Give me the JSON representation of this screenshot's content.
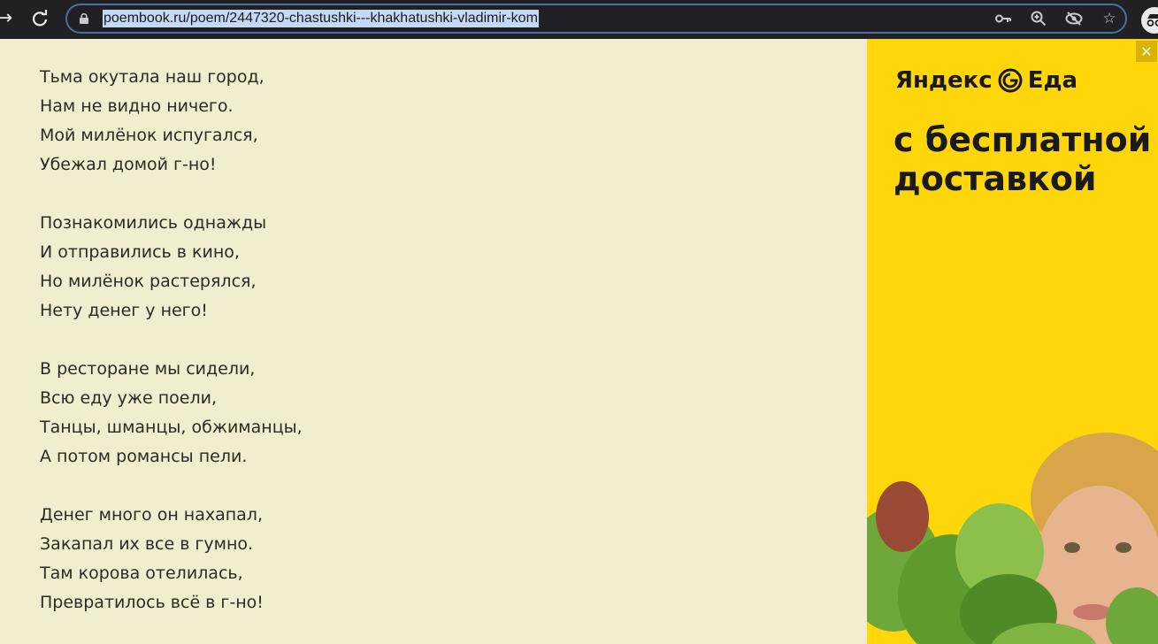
{
  "browser": {
    "url": "poembook.ru/poem/2447320-chastushki---khakhatushki-vladimir-kom"
  },
  "poem": {
    "lines": [
      "Тьма окутала наш город,",
      "Нам не видно ничего.",
      "Мой милёнок испугался,",
      "Убежал домой г-но!",
      "Познакомились однажды",
      "И отправились в кино,",
      "Но милёнок растерялся,",
      "Нету денег у него!",
      "В ресторане мы сидели,",
      "Всю еду уже поели,",
      "Танцы, шманцы, обжиманцы,",
      "А потом романсы пели.",
      "Денег много он нахапал,",
      "Закапал их все в гумно.",
      "Там корова отелилась,",
      "Превратилось всё в г-но!"
    ]
  },
  "ad": {
    "brand_part1": "Яндекс",
    "brand_part2": "Еда",
    "headline": "с бесплатной доставкой",
    "close_label": "✕",
    "bg_color": "#ffd60a"
  }
}
